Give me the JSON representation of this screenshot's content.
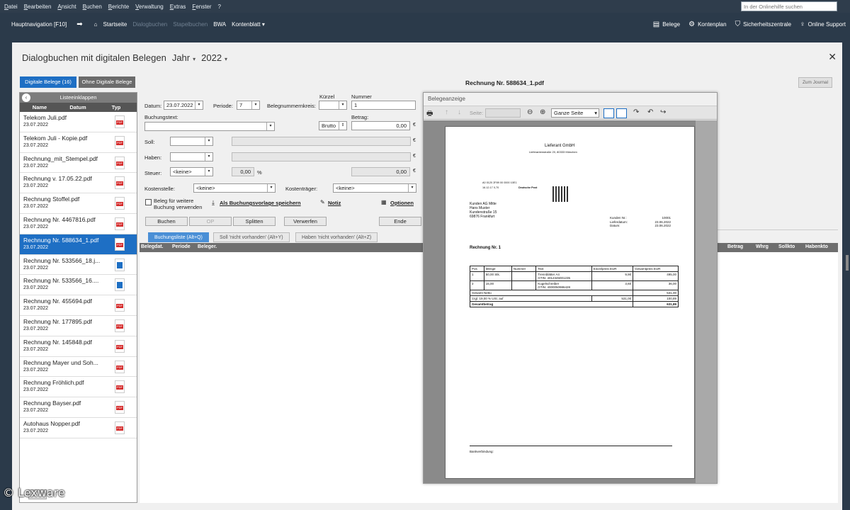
{
  "menu": [
    "Datei",
    "Bearbeiten",
    "Ansicht",
    "Buchen",
    "Berichte",
    "Verwaltung",
    "Extras",
    "Fenster",
    "?"
  ],
  "help_search_placeholder": "In der Onlinehilfe suchen",
  "nav": {
    "main": "Hauptnavigation [F10]",
    "items": [
      {
        "label": "Startseite",
        "enabled": true
      },
      {
        "label": "Dialogbuchen",
        "enabled": false
      },
      {
        "label": "Stapelbuchen",
        "enabled": false
      },
      {
        "label": "BWA",
        "enabled": true
      },
      {
        "label": "Kontenblatt",
        "enabled": true
      }
    ],
    "right": [
      {
        "icon": "receipt-icon",
        "label": "Belege"
      },
      {
        "icon": "gear-icon",
        "label": "Kontenplan"
      },
      {
        "icon": "shield-icon",
        "label": "Sicherheitszentrale"
      },
      {
        "icon": "lightbulb-icon",
        "label": "Online Support"
      }
    ]
  },
  "window": {
    "title": "Dialogbuchen mit digitalen Belegen",
    "period_label": "Jahr",
    "year": "2022"
  },
  "left": {
    "tab_digital": "Digitale Belege (16)",
    "tab_ohne": "Ohne Digitale Belege",
    "collapse": "Listeeinklappen",
    "columns": [
      "Name",
      "Datum",
      "Typ"
    ],
    "docs": [
      {
        "name": "Telekom Juli.pdf",
        "date": "23.07.2022",
        "type": "pdf",
        "selected": false
      },
      {
        "name": "Telekom Juli - Kopie.pdf",
        "date": "23.07.2022",
        "type": "pdf",
        "selected": false
      },
      {
        "name": "Rechnung_mit_Stempel.pdf",
        "date": "23.07.2022",
        "type": "pdf",
        "selected": false
      },
      {
        "name": "Rechnung v. 17.05.22.pdf",
        "date": "23.07.2022",
        "type": "pdf",
        "selected": false
      },
      {
        "name": "Rechnung Stoffel.pdf",
        "date": "23.07.2022",
        "type": "pdf",
        "selected": false
      },
      {
        "name": "Rechnung Nr. 4467816.pdf",
        "date": "23.07.2022",
        "type": "pdf",
        "selected": false
      },
      {
        "name": "Rechnung Nr. 588634_1.pdf",
        "date": "23.07.2022",
        "type": "pdf",
        "selected": true
      },
      {
        "name": "Rechnung  Nr.  533566_18.j...",
        "date": "23.07.2022",
        "type": "img",
        "selected": false
      },
      {
        "name": "Rechnung  Nr.  533566_16....",
        "date": "23.07.2022",
        "type": "img",
        "selected": false
      },
      {
        "name": "Rechnung Nr. 455694.pdf",
        "date": "23.07.2022",
        "type": "pdf",
        "selected": false
      },
      {
        "name": "Rechnung Nr. 177895.pdf",
        "date": "23.07.2022",
        "type": "pdf",
        "selected": false
      },
      {
        "name": "Rechnung Nr. 145848.pdf",
        "date": "23.07.2022",
        "type": "pdf",
        "selected": false
      },
      {
        "name": "Rechnung  Mayer  und Soh...",
        "date": "23.07.2022",
        "type": "pdf",
        "selected": false
      },
      {
        "name": "Rechnung Fröhlich.pdf",
        "date": "23.07.2022",
        "type": "pdf",
        "selected": false
      },
      {
        "name": "Rechnung Bayser.pdf",
        "date": "23.07.2022",
        "type": "pdf",
        "selected": false
      },
      {
        "name": "Autohaus Nopper.pdf",
        "date": "23.07.2022",
        "type": "pdf",
        "selected": false
      }
    ]
  },
  "form": {
    "doc_title": "Rechnung Nr. 588634_1.pdf",
    "zum_journal": "Zum Journal",
    "datum_label": "Datum:",
    "datum_value": "23.07.2022",
    "periode_label": "Periode:",
    "periode_value": "7",
    "belegnummernkreis_label": "Belegnummernkreis:",
    "kuerzel_label": "Kürzel",
    "nummer_label": "Nummer",
    "nummer_value": "1",
    "buchungstext_label": "Buchungstext:",
    "betrag_label": "Betrag:",
    "brutto_value": "Brutto",
    "betrag_value": "0,00",
    "soll_label": "Soll:",
    "haben_label": "Haben:",
    "steuer_label": "Steuer:",
    "steuer_value": "<keine>",
    "steuer_pct": "0,00",
    "pct_sign": "%",
    "steuer_betrag": "0,00",
    "euro": "€",
    "kostenstelle_label": "Kostenstelle:",
    "kostenstelle_value": "<keine>",
    "kostentraeger_label": "Kostenträger:",
    "kostentraeger_value": "<keine>",
    "beleg_check_line1": "Beleg für weitere",
    "beleg_check_line2": "Buchung verwenden",
    "vorlage_link": "Als Buchungsvorlage speichern",
    "notiz_link": "Notiz",
    "optionen_link": "Optionen",
    "buttons": {
      "buchen": "Buchen",
      "op": "OP",
      "splitten": "Splitten",
      "verwerfen": "Verwerfen",
      "ende": "Ende"
    }
  },
  "subtabs": [
    "Buchungsliste (Alt+Q)",
    "Soll 'nicht vorhanden' (Alt+Y)",
    "Haben 'nicht vorhanden' (Alt+Z)"
  ],
  "grid_columns_left": [
    "Belegdat.",
    "Periode",
    "Beleger."
  ],
  "grid_columns_right": [
    "Betrag",
    "Whrg",
    "Sollkto",
    "Habenkto"
  ],
  "viewer": {
    "title": "Belegeanzeige",
    "seite_label": "Seite:",
    "zoom": "Ganze Seite",
    "invoice": {
      "company": "Lieferant GmbH",
      "company_addr": "Lieferantenstraße 20, 80333 München",
      "stamp_line1": "A0 0120 2F89 00 0000 10E1",
      "stamp_line2": "16.12.17 0,70",
      "stamp_post": "Deutsche Post",
      "recipient": [
        "Kunden AG Mitte",
        "Hans Muster",
        "Kundenstraße 15",
        "69876 Frankfurt"
      ],
      "meta_labels": [
        "Kunden Nr.:",
        "Lieferdatum:",
        "Datum:"
      ],
      "meta_values": [
        "10001",
        "23.06.2022",
        "23.06.2022"
      ],
      "heading": "Rechnung Nr. 1",
      "table_head": [
        "Pos",
        "Menge",
        "Nummer",
        "Text",
        "Einzelpreis EUR",
        "Gesamtpreis EUR"
      ],
      "rows": [
        {
          "pos": "1",
          "menge": "50,00",
          "einheit": "Stk.",
          "nummer": "",
          "text": "Trennblätter A4",
          "gtin": "GTIN: 4012345001235",
          "ep": "9,90",
          "gp": "495,00"
        },
        {
          "pos": "2",
          "menge": "15,00",
          "einheit": "",
          "nummer": "",
          "text": "Kugelschreiber",
          "gtin": "GTIN: 4000050986428",
          "ep": "3,60",
          "gp": "36,00"
        }
      ],
      "gesamt_netto_label": "Gesamt Netto",
      "gesamt_netto": "531,00",
      "ust_label": "zzgl. 19,00 % USt. auf",
      "ust_base": "531,00",
      "ust": "100,89",
      "gesamt_label": "Gesamtbetrag",
      "gesamt": "631,89",
      "bank_label": "Bankverbindung:"
    }
  },
  "watermark": "© Lexware"
}
